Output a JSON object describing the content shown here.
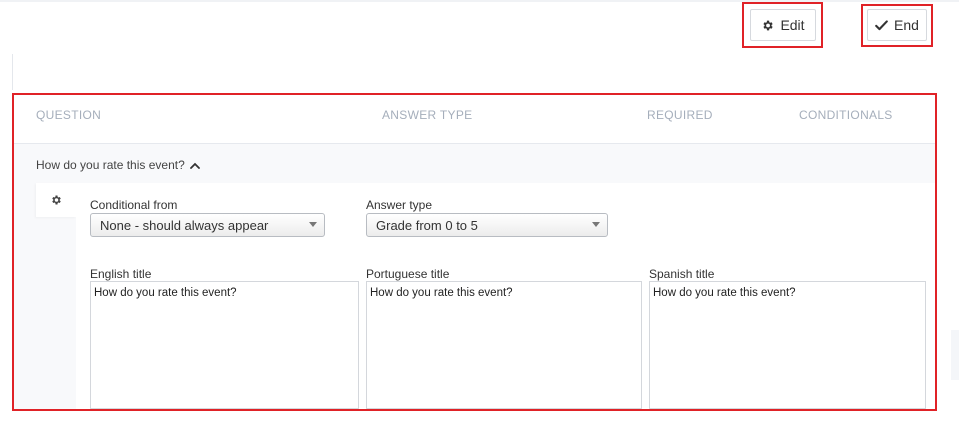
{
  "toolbar": {
    "edit_label": "Edit",
    "end_label": "End"
  },
  "table": {
    "columns": {
      "question": "QUESTION",
      "answer_type": "ANSWER TYPE",
      "required": "REQUIRED",
      "conditionals": "CONDITIONALS"
    },
    "row": {
      "question_title": "How do you rate this event?"
    }
  },
  "editor": {
    "conditional_from": {
      "label": "Conditional from",
      "value": "None - should always appear"
    },
    "answer_type": {
      "label": "Answer type",
      "value": "Grade from 0 to 5"
    },
    "titles": [
      {
        "label": "English title",
        "value": "How do you rate this event?"
      },
      {
        "label": "Portuguese title",
        "value": "How do you rate this event?"
      },
      {
        "label": "Spanish title",
        "value": "How do you rate this event?"
      }
    ]
  },
  "icons": {
    "edit": "gear-icon",
    "end": "checkmark-icon",
    "collapse": "chevron-up-icon",
    "settings": "gear-icon"
  },
  "colors": {
    "highlight": "#e02227",
    "header_text": "#a5aebb",
    "row_background": "#f8f9fb"
  }
}
